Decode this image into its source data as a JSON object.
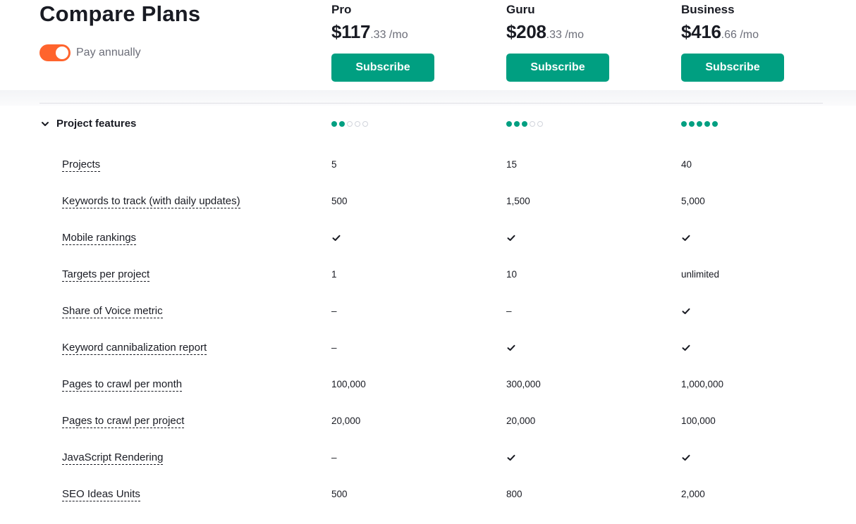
{
  "header": {
    "title": "Compare Plans",
    "billing_toggle": {
      "label": "Pay annually",
      "on": true,
      "color": "#ff642d"
    }
  },
  "plans": [
    {
      "name": "Pro",
      "price_main": "$117",
      "price_cents": ".33",
      "period": " /mo",
      "button": "Subscribe",
      "level": 2
    },
    {
      "name": "Guru",
      "price_main": "$208",
      "price_cents": ".33",
      "period": " /mo",
      "button": "Subscribe",
      "level": 3
    },
    {
      "name": "Business",
      "price_main": "$416",
      "price_cents": ".66",
      "period": " /mo",
      "button": "Subscribe",
      "level": 5
    }
  ],
  "level_max": 5,
  "colors": {
    "accent": "#009f81",
    "toggle": "#ff642d",
    "text": "#191b23",
    "muted": "#6c6e79"
  },
  "section": {
    "title": "Project features",
    "expanded": true,
    "rows": [
      {
        "label": "Projects",
        "values": [
          "5",
          "15",
          "40"
        ]
      },
      {
        "label": "Keywords to track (with daily updates)",
        "values": [
          "500",
          "1,500",
          "5,000"
        ]
      },
      {
        "label": "Mobile rankings",
        "values": [
          "check",
          "check",
          "check"
        ]
      },
      {
        "label": "Targets per project",
        "values": [
          "1",
          "10",
          "unlimited"
        ]
      },
      {
        "label": "Share of Voice metric",
        "values": [
          "–",
          "–",
          "check"
        ]
      },
      {
        "label": "Keyword cannibalization report",
        "values": [
          "–",
          "check",
          "check"
        ]
      },
      {
        "label": "Pages to crawl per month",
        "values": [
          "100,000",
          "300,000",
          "1,000,000"
        ]
      },
      {
        "label": "Pages to crawl per project",
        "values": [
          "20,000",
          "20,000",
          "100,000"
        ]
      },
      {
        "label": "JavaScript Rendering",
        "values": [
          "–",
          "check",
          "check"
        ]
      },
      {
        "label": "SEO Ideas Units",
        "values": [
          "500",
          "800",
          "2,000"
        ]
      }
    ]
  }
}
